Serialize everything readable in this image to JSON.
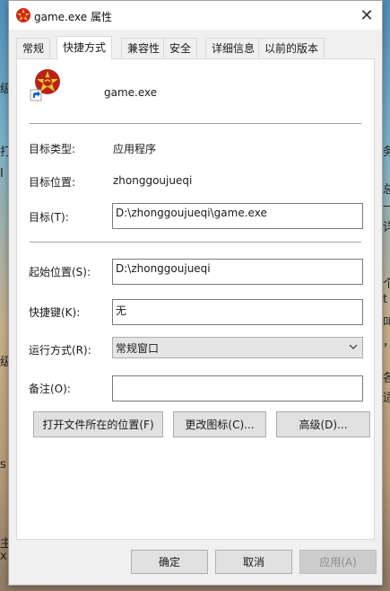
{
  "window": {
    "title": "game.exe 属性",
    "close_glyph": "✕"
  },
  "tabs": [
    {
      "label": "常规"
    },
    {
      "label": "快捷方式"
    },
    {
      "label": "兼容性"
    },
    {
      "label": "安全"
    },
    {
      "label": "详细信息"
    },
    {
      "label": "以前的版本"
    }
  ],
  "shortcut": {
    "name": "game.exe",
    "target_type_label": "目标类型:",
    "target_type_value": "应用程序",
    "target_location_label": "目标位置:",
    "target_location_value": "zhonggoujueqi",
    "target_label": "目标(T):",
    "target_value": "D:\\zhonggoujueqi\\game.exe",
    "start_in_label": "起始位置(S):",
    "start_in_value": "D:\\zhonggoujueqi",
    "hotkey_label": "快捷键(K):",
    "hotkey_value": "无",
    "run_label": "运行方式(R):",
    "run_value": "常规窗口",
    "comment_label": "备注(O):",
    "comment_value": "",
    "open_location_button": "打开文件所在的位置(F)",
    "change_icon_button": "更改图标(C)...",
    "advanced_button": "高级(D)..."
  },
  "footer": {
    "ok": "确定",
    "cancel": "取消",
    "apply": "应用(A)"
  },
  "background_fragments": [
    "级",
    "打",
    "I",
    "级",
    "s",
    "主",
    "x",
    "务",
    "总",
    "—",
    "详",
    "个",
    "t",
    "叫",
    "，",
    "各",
    "适"
  ]
}
